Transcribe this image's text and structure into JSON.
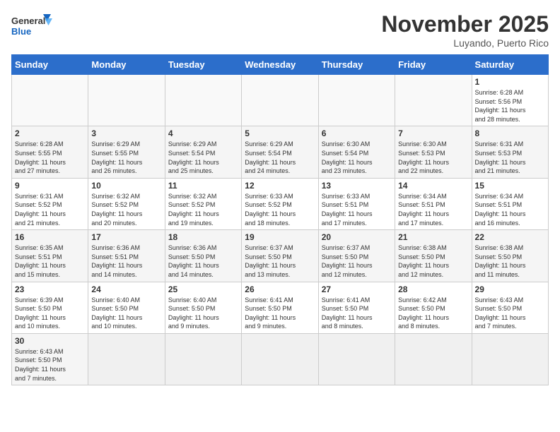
{
  "logo": {
    "text_general": "General",
    "text_blue": "Blue"
  },
  "title": "November 2025",
  "location": "Luyando, Puerto Rico",
  "days_of_week": [
    "Sunday",
    "Monday",
    "Tuesday",
    "Wednesday",
    "Thursday",
    "Friday",
    "Saturday"
  ],
  "weeks": [
    [
      {
        "day": null,
        "info": null
      },
      {
        "day": null,
        "info": null
      },
      {
        "day": null,
        "info": null
      },
      {
        "day": null,
        "info": null
      },
      {
        "day": null,
        "info": null
      },
      {
        "day": null,
        "info": null
      },
      {
        "day": "1",
        "info": "Sunrise: 6:28 AM\nSunset: 5:56 PM\nDaylight: 11 hours\nand 28 minutes."
      }
    ],
    [
      {
        "day": "2",
        "info": "Sunrise: 6:28 AM\nSunset: 5:55 PM\nDaylight: 11 hours\nand 27 minutes."
      },
      {
        "day": "3",
        "info": "Sunrise: 6:29 AM\nSunset: 5:55 PM\nDaylight: 11 hours\nand 26 minutes."
      },
      {
        "day": "4",
        "info": "Sunrise: 6:29 AM\nSunset: 5:54 PM\nDaylight: 11 hours\nand 25 minutes."
      },
      {
        "day": "5",
        "info": "Sunrise: 6:29 AM\nSunset: 5:54 PM\nDaylight: 11 hours\nand 24 minutes."
      },
      {
        "day": "6",
        "info": "Sunrise: 6:30 AM\nSunset: 5:54 PM\nDaylight: 11 hours\nand 23 minutes."
      },
      {
        "day": "7",
        "info": "Sunrise: 6:30 AM\nSunset: 5:53 PM\nDaylight: 11 hours\nand 22 minutes."
      },
      {
        "day": "8",
        "info": "Sunrise: 6:31 AM\nSunset: 5:53 PM\nDaylight: 11 hours\nand 21 minutes."
      }
    ],
    [
      {
        "day": "9",
        "info": "Sunrise: 6:31 AM\nSunset: 5:52 PM\nDaylight: 11 hours\nand 21 minutes."
      },
      {
        "day": "10",
        "info": "Sunrise: 6:32 AM\nSunset: 5:52 PM\nDaylight: 11 hours\nand 20 minutes."
      },
      {
        "day": "11",
        "info": "Sunrise: 6:32 AM\nSunset: 5:52 PM\nDaylight: 11 hours\nand 19 minutes."
      },
      {
        "day": "12",
        "info": "Sunrise: 6:33 AM\nSunset: 5:52 PM\nDaylight: 11 hours\nand 18 minutes."
      },
      {
        "day": "13",
        "info": "Sunrise: 6:33 AM\nSunset: 5:51 PM\nDaylight: 11 hours\nand 17 minutes."
      },
      {
        "day": "14",
        "info": "Sunrise: 6:34 AM\nSunset: 5:51 PM\nDaylight: 11 hours\nand 17 minutes."
      },
      {
        "day": "15",
        "info": "Sunrise: 6:34 AM\nSunset: 5:51 PM\nDaylight: 11 hours\nand 16 minutes."
      }
    ],
    [
      {
        "day": "16",
        "info": "Sunrise: 6:35 AM\nSunset: 5:51 PM\nDaylight: 11 hours\nand 15 minutes."
      },
      {
        "day": "17",
        "info": "Sunrise: 6:36 AM\nSunset: 5:51 PM\nDaylight: 11 hours\nand 14 minutes."
      },
      {
        "day": "18",
        "info": "Sunrise: 6:36 AM\nSunset: 5:50 PM\nDaylight: 11 hours\nand 14 minutes."
      },
      {
        "day": "19",
        "info": "Sunrise: 6:37 AM\nSunset: 5:50 PM\nDaylight: 11 hours\nand 13 minutes."
      },
      {
        "day": "20",
        "info": "Sunrise: 6:37 AM\nSunset: 5:50 PM\nDaylight: 11 hours\nand 12 minutes."
      },
      {
        "day": "21",
        "info": "Sunrise: 6:38 AM\nSunset: 5:50 PM\nDaylight: 11 hours\nand 12 minutes."
      },
      {
        "day": "22",
        "info": "Sunrise: 6:38 AM\nSunset: 5:50 PM\nDaylight: 11 hours\nand 11 minutes."
      }
    ],
    [
      {
        "day": "23",
        "info": "Sunrise: 6:39 AM\nSunset: 5:50 PM\nDaylight: 11 hours\nand 10 minutes."
      },
      {
        "day": "24",
        "info": "Sunrise: 6:40 AM\nSunset: 5:50 PM\nDaylight: 11 hours\nand 10 minutes."
      },
      {
        "day": "25",
        "info": "Sunrise: 6:40 AM\nSunset: 5:50 PM\nDaylight: 11 hours\nand 9 minutes."
      },
      {
        "day": "26",
        "info": "Sunrise: 6:41 AM\nSunset: 5:50 PM\nDaylight: 11 hours\nand 9 minutes."
      },
      {
        "day": "27",
        "info": "Sunrise: 6:41 AM\nSunset: 5:50 PM\nDaylight: 11 hours\nand 8 minutes."
      },
      {
        "day": "28",
        "info": "Sunrise: 6:42 AM\nSunset: 5:50 PM\nDaylight: 11 hours\nand 8 minutes."
      },
      {
        "day": "29",
        "info": "Sunrise: 6:43 AM\nSunset: 5:50 PM\nDaylight: 11 hours\nand 7 minutes."
      }
    ],
    [
      {
        "day": "30",
        "info": "Sunrise: 6:43 AM\nSunset: 5:50 PM\nDaylight: 11 hours\nand 7 minutes."
      },
      {
        "day": null,
        "info": null
      },
      {
        "day": null,
        "info": null
      },
      {
        "day": null,
        "info": null
      },
      {
        "day": null,
        "info": null
      },
      {
        "day": null,
        "info": null
      },
      {
        "day": null,
        "info": null
      }
    ]
  ]
}
